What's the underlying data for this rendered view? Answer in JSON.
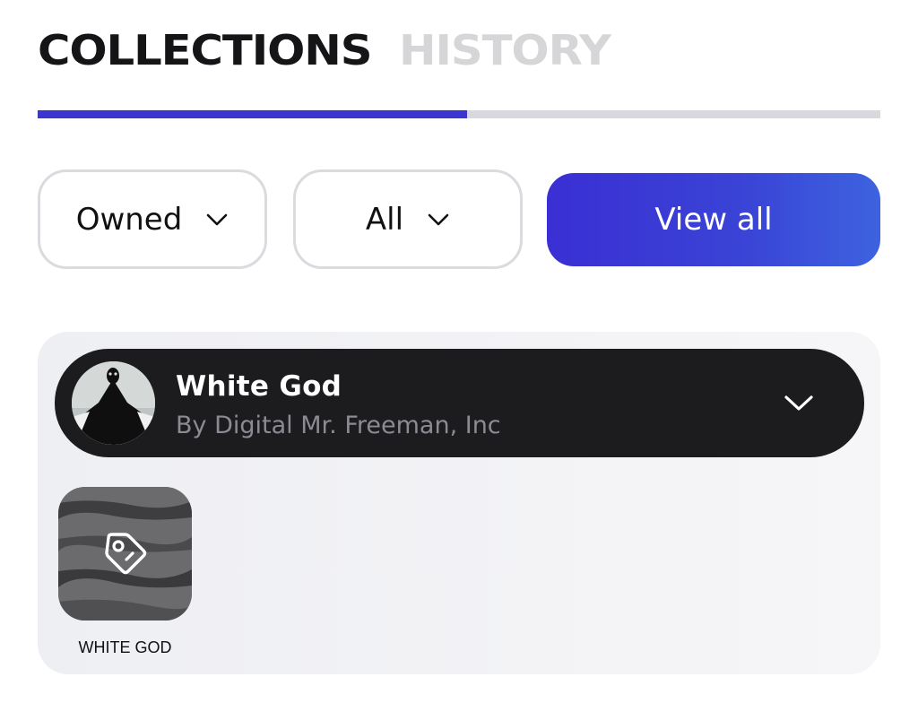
{
  "tabs": {
    "collections": "COLLECTIONS",
    "history": "HISTORY"
  },
  "tab_indicator_progress": 0.51,
  "filters": {
    "ownership": "Owned",
    "category": "All",
    "view_all": "View all"
  },
  "collection": {
    "title": "White God",
    "subtitle": "By Digital Mr. Freeman, Inc",
    "items": [
      {
        "label": "WHITE GOD"
      }
    ]
  },
  "colors": {
    "accent": "#3b35d2",
    "header_bg": "#1c1c1f",
    "panel_bg": "#f1f1f4"
  },
  "icons": {
    "dropdown": "chevron-down-icon",
    "item": "tag-icon"
  }
}
